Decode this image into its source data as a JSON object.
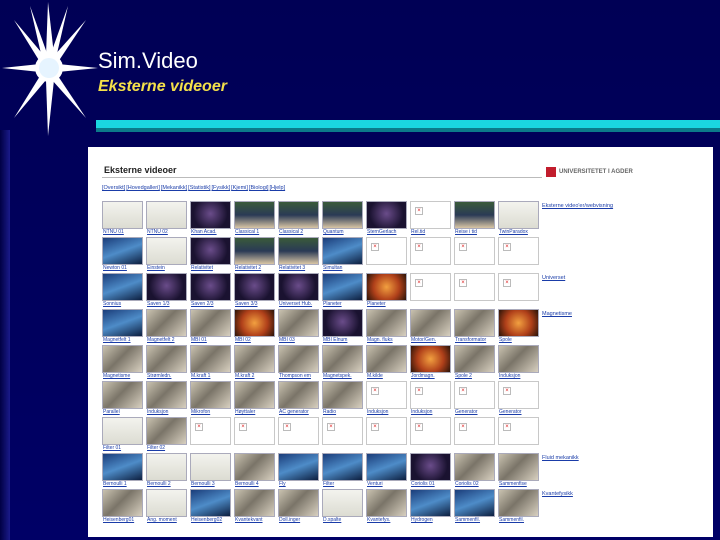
{
  "slide": {
    "title": "Sim.Video",
    "subtitle": "Eksterne videoer",
    "colors": {
      "background": "#000066",
      "accent": "#1ad6e0",
      "subtitle": "#f4e04a"
    }
  },
  "screen": {
    "page_title": "Eksterne videoer",
    "logo_text": "UNIVERSITETET I AGDER",
    "nav": [
      "[Oversikt]",
      "[Hovedgalleri]",
      "[Mekanikk]",
      "[Statistik]",
      "[Fysikk]",
      "[Kjemi]",
      "[Biologi]",
      "[Hjelp]"
    ],
    "grid": [
      [
        {
          "label": "NTNU 01",
          "img": "doc"
        },
        {
          "label": "NTNU 02",
          "img": "doc"
        },
        {
          "label": "Khan Acad.",
          "img": "dark"
        },
        {
          "label": "Classical 1",
          "img": "person"
        },
        {
          "label": "Classical 2",
          "img": "person"
        },
        {
          "label": "Quantum",
          "img": "person"
        },
        {
          "label": "SternGerlach",
          "img": "dark"
        },
        {
          "label": "Rel.tid",
          "img": "broken"
        },
        {
          "label": "Reise i tid",
          "img": "person"
        },
        {
          "label": "TwinParadox",
          "img": "doc"
        }
      ],
      [
        {
          "label": "Newton 01",
          "img": "blue"
        },
        {
          "label": "Einstein",
          "img": "doc"
        },
        {
          "label": "Relativitet",
          "img": "dark"
        },
        {
          "label": "Relativitet 2",
          "img": "person"
        },
        {
          "label": "Relativitet 3",
          "img": "person"
        },
        {
          "label": "Simultan",
          "img": "blue"
        },
        {
          "label": "",
          "img": "broken"
        },
        {
          "label": "",
          "img": "broken"
        },
        {
          "label": "",
          "img": "broken"
        },
        {
          "label": "",
          "img": "broken"
        }
      ],
      [
        {
          "label": "Sonnius",
          "img": "blue"
        },
        {
          "label": "Saven 1/3",
          "img": "dark"
        },
        {
          "label": "Saven 2/3",
          "img": "dark"
        },
        {
          "label": "Saven 3/3",
          "img": "dark"
        },
        {
          "label": "Universet Hub.",
          "img": "dark"
        },
        {
          "label": "Planeter",
          "img": "blue"
        },
        {
          "label": "Planeter",
          "img": "orange"
        },
        {
          "label": "",
          "img": "broken"
        },
        {
          "label": "",
          "img": "broken"
        },
        {
          "label": "",
          "img": "broken"
        }
      ],
      [
        {
          "label": "Magnetfelt 1",
          "img": "blue"
        },
        {
          "label": "Magnetfelt 2",
          "img": "lab"
        },
        {
          "label": "MBI 01",
          "img": "lab"
        },
        {
          "label": "MBI 02",
          "img": "orange"
        },
        {
          "label": "MBI 03",
          "img": "lab"
        },
        {
          "label": "MBI Elnum",
          "img": "dark"
        },
        {
          "label": "Magn. fluks",
          "img": "lab"
        },
        {
          "label": "Motor/Gen.",
          "img": "lab"
        },
        {
          "label": "Transformator",
          "img": "lab"
        },
        {
          "label": "Spole",
          "img": "orange"
        }
      ],
      [
        {
          "label": "Magnetisme",
          "img": "lab"
        },
        {
          "label": "Strømledn.",
          "img": "lab"
        },
        {
          "label": "M.kraft 1",
          "img": "lab"
        },
        {
          "label": "M.kraft 2",
          "img": "lab"
        },
        {
          "label": "Thompson em",
          "img": "lab"
        },
        {
          "label": "Magnetspek.",
          "img": "lab"
        },
        {
          "label": "M.kilde",
          "img": "lab"
        },
        {
          "label": "Jordmagn.",
          "img": "orange"
        },
        {
          "label": "Spole 2",
          "img": "lab"
        },
        {
          "label": "Induksjon",
          "img": "lab"
        }
      ],
      [
        {
          "label": "Parallel",
          "img": "lab"
        },
        {
          "label": "Induksjon",
          "img": "lab"
        },
        {
          "label": "Mikrofon",
          "img": "lab"
        },
        {
          "label": "Høyttaler",
          "img": "lab"
        },
        {
          "label": "AC generator",
          "img": "lab"
        },
        {
          "label": "Radio",
          "img": "lab"
        },
        {
          "label": "Induksjon",
          "img": "broken"
        },
        {
          "label": "Induksjon",
          "img": "broken"
        },
        {
          "label": "Generator",
          "img": "broken"
        },
        {
          "label": "Generator",
          "img": "broken"
        }
      ],
      [
        {
          "label": "Filter 01",
          "img": "doc"
        },
        {
          "label": "Filter 02",
          "img": "lab"
        },
        {
          "label": "",
          "img": "broken"
        },
        {
          "label": "",
          "img": "broken"
        },
        {
          "label": "",
          "img": "broken"
        },
        {
          "label": "",
          "img": "broken"
        },
        {
          "label": "",
          "img": "broken"
        },
        {
          "label": "",
          "img": "broken"
        },
        {
          "label": "",
          "img": "broken"
        },
        {
          "label": "",
          "img": "broken"
        }
      ],
      [
        {
          "label": "Bernoulli 1",
          "img": "blue"
        },
        {
          "label": "Bernoulli 2",
          "img": "doc"
        },
        {
          "label": "Bernoulli 3",
          "img": "doc"
        },
        {
          "label": "Bernoulli 4",
          "img": "lab"
        },
        {
          "label": "Fly",
          "img": "blue"
        },
        {
          "label": "Filter",
          "img": "blue"
        },
        {
          "label": "Venturi",
          "img": "blue"
        },
        {
          "label": "Coriolis 01",
          "img": "dark"
        },
        {
          "label": "Coriolis 02",
          "img": "lab"
        },
        {
          "label": "Sammenfise",
          "img": "lab"
        }
      ],
      [
        {
          "label": "Heisenberg01",
          "img": "lab"
        },
        {
          "label": "Ang. moment",
          "img": "doc"
        },
        {
          "label": "Heisenberg02",
          "img": "blue"
        },
        {
          "label": "Kvantekvant",
          "img": "lab"
        },
        {
          "label": "Doll.inger",
          "img": "lab"
        },
        {
          "label": "D.spalte",
          "img": "doc"
        },
        {
          "label": "Kvantefys.",
          "img": "lab"
        },
        {
          "label": "Hydrogen",
          "img": "blue"
        },
        {
          "label": "Sammenfil.",
          "img": "blue"
        },
        {
          "label": "Sammenfil.",
          "img": "lab"
        }
      ]
    ],
    "side_links": [
      {
        "label": "Eksterne video'er/webvisning",
        "row": 0
      },
      {
        "label": "Universet",
        "row": 2
      },
      {
        "label": "Magnetisme",
        "row": 3
      },
      {
        "label": "Fluid mekanikk",
        "row": 7
      },
      {
        "label": "Kvantefysikk",
        "row": 8
      }
    ]
  }
}
